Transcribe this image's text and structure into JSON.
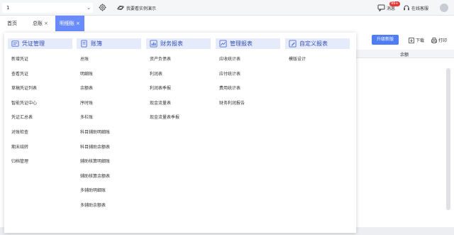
{
  "topbar": {
    "company_value": "1",
    "demo_text": "我要看实例演示",
    "messages_label": "消息",
    "messages_badge": "99+",
    "service_label": "在线客服"
  },
  "tabs": [
    {
      "label": "首页"
    },
    {
      "label": "总账"
    },
    {
      "label": "明细账"
    }
  ],
  "toolbar": {
    "upgrade_label": "升级新版",
    "download_label": "下载",
    "print_label": "打印"
  },
  "table": {
    "balance_header": "余额"
  },
  "menu": {
    "columns": [
      {
        "title": "凭证管理",
        "icon": "voucher-icon",
        "items": [
          "新增凭证",
          "查看凭证",
          "草稿凭证列表",
          "智能凭证中心",
          "凭证汇总表",
          "对账检查",
          "期末结转",
          "归档管理"
        ]
      },
      {
        "title": "账簿",
        "icon": "ledger-icon",
        "items": [
          "总账",
          "明细账",
          "余额表",
          "序时账",
          "多栏账",
          "科目辅助明细账",
          "科目辅助余额表",
          "辅助核算明细账",
          "辅助核算余额表",
          "多辅助明细账",
          "多辅助余额表"
        ]
      },
      {
        "title": "财务报表",
        "icon": "financial-report-icon",
        "items": [
          "资产负债表",
          "利润表",
          "利润表季报",
          "现金流量表",
          "现金流量表季报"
        ]
      },
      {
        "title": "管理报表",
        "icon": "management-report-icon",
        "items": [
          "应收统计表",
          "应付统计表",
          "费用统计表",
          "财务利润报告"
        ]
      },
      {
        "title": "自定义报表",
        "icon": "custom-report-icon",
        "items": [
          "模版设计"
        ]
      }
    ]
  },
  "colors": {
    "accent": "#4f7df3",
    "tab_active": "#6a8cfb",
    "menu_header_bg": "#e6ebfb",
    "menu_header_text": "#2f4fb8"
  }
}
